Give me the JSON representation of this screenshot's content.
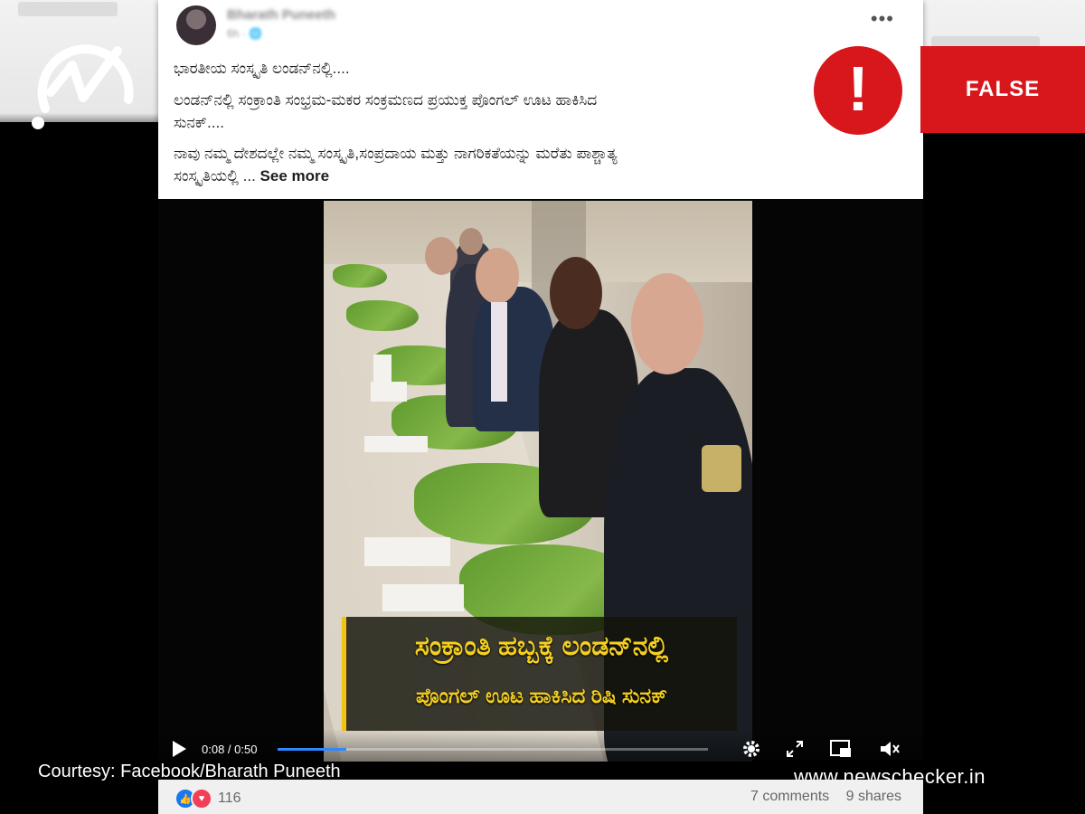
{
  "post": {
    "author_name": "Bharath Puneeth",
    "author_meta": "6h · 🌐",
    "more_icon": "•••",
    "lines": [
      "ಭಾರತೀಯ ಸಂಸ್ಕೃತಿ ಲಂಡನ್‌ನಲ್ಲಿ....",
      "ಲಂಡನ್‌ನಲ್ಲಿ ಸಂಕ್ರಾಂತಿ ಸಂಭ್ರಮ-ಮಕರ ಸಂಕ್ರಮಣದ ಪ್ರಯುಕ್ತ ಪೊಂಗಲ್ ಊಟ ಹಾಕಿಸಿದ",
      "ಸುನಕ್....",
      "ನಾವು ನಮ್ಮ ದೇಶದಲ್ಲೇ ನಮ್ಮ ಸಂಸ್ಕೃತಿ,ಸಂಪ್ರದಾಯ ಮತ್ತು ನಾಗರಿಕತೆಯನ್ನು ಮರೆತು ಪಾಶ್ಚಾತ್ಯ",
      "ಸಂಸ್ಕೃತಿಯಲ್ಲಿ ... "
    ],
    "see_more": "See more"
  },
  "verdict": {
    "mark": "!",
    "label": "FALSE",
    "color": "#d8171d"
  },
  "video": {
    "caption_line1": "ಸಂಕ್ರಾಂತಿ ಹಬ್ಬಕ್ಕೆ ಲಂಡನ್‌ನಲ್ಲಿ",
    "caption_line2": "ಪೊಂಗಲ್ ಊಟ ಹಾಕಿಸಿದ ರಿಷಿ ಸುನಕ್",
    "time_current": "0:08",
    "time_total": "0:50",
    "timecode": "0:08 / 0:50",
    "progress_fraction": 0.16
  },
  "footer": {
    "reaction_count": "116",
    "comments": "7 comments",
    "shares": "9 shares"
  },
  "overlay": {
    "courtesy": "Courtesy: Facebook/Bharath Puneeth",
    "site": "www.newschecker.in"
  }
}
